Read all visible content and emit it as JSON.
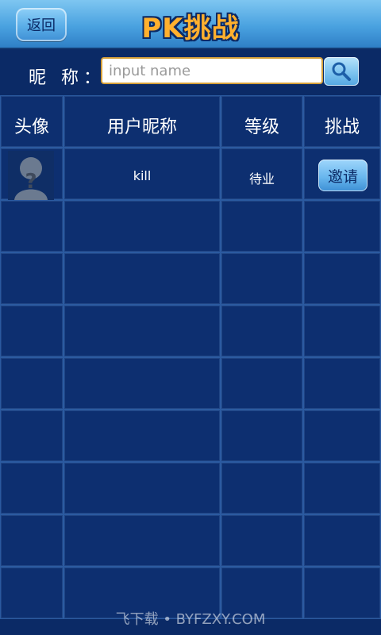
{
  "topbar": {
    "back_label": "返回",
    "title": "PK挑战"
  },
  "search": {
    "label": "昵 称：",
    "placeholder": "input name",
    "value": "",
    "button_icon": "search-icon"
  },
  "table": {
    "headers": [
      "头像",
      "用户昵称",
      "等级",
      "挑战"
    ],
    "rows": [
      {
        "avatar_icon": "default-avatar-icon",
        "nickname": "kill",
        "level": "待业",
        "action_label": "邀请"
      }
    ]
  },
  "watermark": "飞下载 • BYFZXY.COM",
  "colors": {
    "background": "#0b2a66",
    "topbar_accent": "#4aa2e0",
    "title": "#ffb02e",
    "input_border": "#d6a03a"
  }
}
